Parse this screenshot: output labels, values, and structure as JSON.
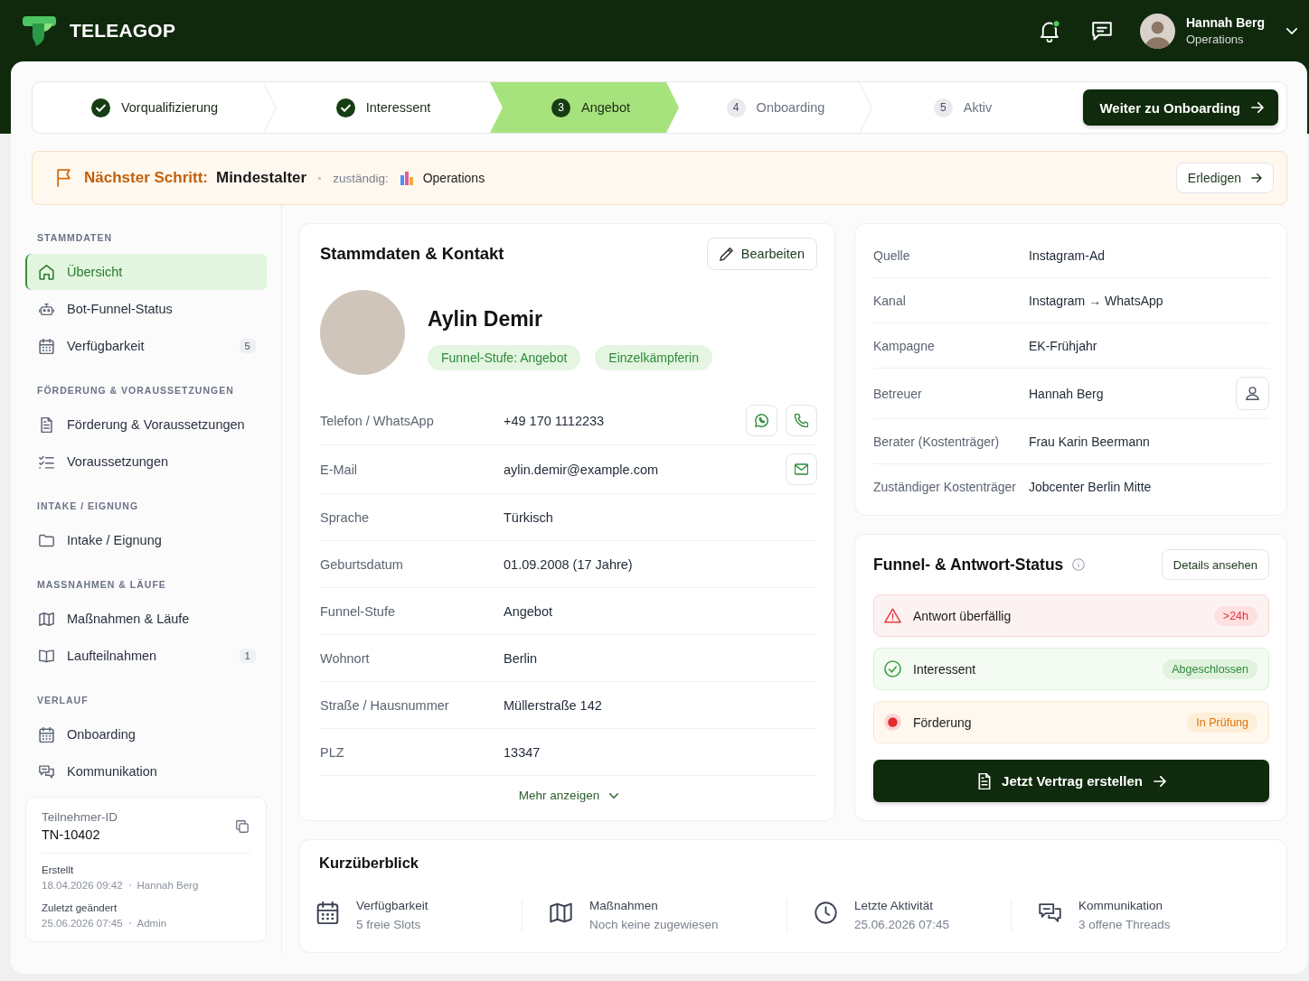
{
  "app": {
    "name": "TELEAGOP"
  },
  "top_bar": {
    "notifications_unread": true,
    "user": {
      "name": "Hannah Berg",
      "role": "Operations"
    }
  },
  "stepper": {
    "steps": [
      {
        "label": "Vorqualifizierung",
        "done": true,
        "selected": false
      },
      {
        "label": "Interessent",
        "done": true,
        "selected": false
      },
      {
        "number": "3",
        "label": "Angebot",
        "done": false,
        "selected": true
      },
      {
        "number": "4",
        "label": "Onboarding",
        "done": false,
        "selected": false
      },
      {
        "number": "5",
        "label": "Aktiv",
        "done": false,
        "selected": false
      }
    ],
    "next_button": "Weiter zu Onboarding"
  },
  "next_step": {
    "label": "Nächster Schritt:",
    "value": "Mindestalter",
    "owner_label": "zuständig:",
    "owner": "Operations",
    "button": "Erledigen"
  },
  "sidebar": {
    "sections": [
      {
        "title": "STAMMDATEN",
        "items": [
          {
            "label": "Übersicht",
            "selected": true
          },
          {
            "label": "Bot-Funnel-Status",
            "selected": false
          },
          {
            "label": "Verfügbarkeit",
            "badge": "5",
            "selected": false
          }
        ]
      },
      {
        "title": "FÖRDERUNG & VORAUSSETZUNGEN",
        "items": [
          {
            "label": "Förderung & Voraussetzungen",
            "selected": false
          },
          {
            "label": "Voraussetzungen",
            "selected": false
          }
        ]
      },
      {
        "title": "INTAKE / EIGNUNG",
        "items": [
          {
            "label": "Intake / Eignung",
            "selected": false
          }
        ]
      },
      {
        "title": "MASSNAHMEN & LÄUFE",
        "items": [
          {
            "label": "Maßnahmen & Läufe",
            "selected": false
          },
          {
            "label": "Laufteilnahmen",
            "badge": "1",
            "selected": false
          }
        ]
      },
      {
        "title": "VERLAUF",
        "items": [
          {
            "label": "Onboarding",
            "selected": false
          },
          {
            "label": "Kommunikation",
            "selected": false
          }
        ]
      }
    ],
    "record": {
      "id_label": "Teilnehmer-ID",
      "id": "TN-10402",
      "created": {
        "label": "Erstellt",
        "time": "18.04.2026 09:42",
        "by": "Hannah Berg"
      },
      "modified": {
        "label": "Zuletzt geändert",
        "time": "25.06.2026 07:45",
        "by": "Admin"
      }
    }
  },
  "contact_card": {
    "title": "Stammdaten & Kontakt",
    "edit_button": "Bearbeiten",
    "name": "Aylin Demir",
    "tags": [
      "Funnel-Stufe: Angebot",
      "Einzelkämpferin"
    ],
    "rows": [
      {
        "kind": "phone",
        "label": "Telefon / WhatsApp",
        "value": "+49 170 1112233"
      },
      {
        "kind": "email",
        "label": "E-Mail",
        "value": "aylin.demir@example.com"
      },
      {
        "kind": "text",
        "label": "Sprache",
        "value": "Türkisch"
      },
      {
        "kind": "text",
        "label": "Geburtsdatum",
        "value": "01.09.2008 (17 Jahre)"
      },
      {
        "kind": "text",
        "label": "Funnel-Stufe",
        "value": "Angebot"
      },
      {
        "kind": "text",
        "label": "Wohnort",
        "value": "Berlin"
      },
      {
        "kind": "text",
        "label": "Straße / Hausnummer",
        "value": "Müllerstraße 142"
      },
      {
        "kind": "text",
        "label": "PLZ",
        "value": "13347"
      }
    ],
    "more_button": "Mehr anzeigen"
  },
  "source_card": {
    "rows": [
      {
        "kind": "text",
        "label": "Quelle",
        "value": "Instagram-Ad"
      },
      {
        "kind": "text",
        "label": "Kanal",
        "value": "Instagram → WhatsApp"
      },
      {
        "kind": "text",
        "label": "Kampagne",
        "value": "EK-Frühjahr"
      },
      {
        "kind": "person",
        "label": "Betreuer",
        "value": "Hannah Berg"
      },
      {
        "kind": "text",
        "label": "Berater (Kostenträger)",
        "value": "Frau Karin Beermann"
      },
      {
        "kind": "text",
        "label": "Zuständiger Kostenträger",
        "value": "Jobcenter Berlin Mitte"
      }
    ]
  },
  "status_card": {
    "title": "Funnel- & Antwort-Status",
    "details_button": "Details ansehen",
    "items": [
      {
        "kind": "overdue",
        "label": "Antwort überfällig",
        "badge": ">24h"
      },
      {
        "kind": "done",
        "label": "Interessent",
        "badge": "Abgeschlossen"
      },
      {
        "kind": "pending",
        "label": "Förderung",
        "badge": "In Prüfung"
      }
    ],
    "action_button": "Jetzt Vertrag erstellen"
  },
  "overview": {
    "title": "Kurzüberblick",
    "items": [
      {
        "label": "Verfügbarkeit",
        "value": "5 freie Slots"
      },
      {
        "label": "Maßnahmen",
        "value": "Noch keine zugewiesen"
      },
      {
        "label": "Letzte Aktivität",
        "value": "25.06.2026 07:45"
      },
      {
        "label": "Kommunikation",
        "value": "3 offene Threads"
      }
    ]
  }
}
